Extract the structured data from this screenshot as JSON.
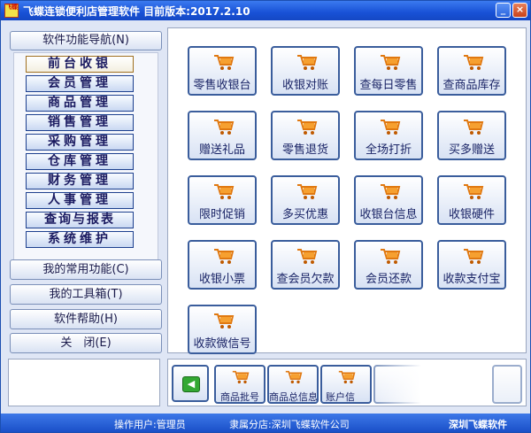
{
  "window": {
    "title": "飞蝶连锁便利店管理软件 目前版本:2017.2.10",
    "icon_text": "飞蝶"
  },
  "sidebar": {
    "header": "软件功能导航(N)",
    "items": [
      {
        "label": "前台收银",
        "active": true
      },
      {
        "label": "会员管理"
      },
      {
        "label": "商品管理"
      },
      {
        "label": "销售管理"
      },
      {
        "label": "采购管理"
      },
      {
        "label": "仓库管理"
      },
      {
        "label": "财务管理"
      },
      {
        "label": "人事管理"
      },
      {
        "label": "查询与报表"
      },
      {
        "label": "系统维护"
      }
    ],
    "buttons": [
      {
        "label": "我的常用功能(C)"
      },
      {
        "label": "我的工具箱(T)"
      },
      {
        "label": "软件帮助(H)"
      },
      {
        "label": "关　闭(E)"
      }
    ]
  },
  "main": {
    "buttons": [
      {
        "label": "零售收银台",
        "icon": "shopping-cart-icon"
      },
      {
        "label": "收银对账",
        "icon": "shopping-cart-icon"
      },
      {
        "label": "查每日零售",
        "icon": "shopping-cart-icon"
      },
      {
        "label": "查商品库存",
        "icon": "shopping-cart-icon"
      },
      {
        "label": "赠送礼品",
        "icon": "shopping-cart-icon"
      },
      {
        "label": "零售退货",
        "icon": "shopping-cart-icon"
      },
      {
        "label": "全场打折",
        "icon": "shopping-cart-icon"
      },
      {
        "label": "买多赠送",
        "icon": "shopping-cart-icon"
      },
      {
        "label": "限时促销",
        "icon": "shopping-cart-icon"
      },
      {
        "label": "多买优惠",
        "icon": "shopping-cart-icon"
      },
      {
        "label": "收银台信息",
        "icon": "shopping-cart-icon"
      },
      {
        "label": "收银硬件",
        "icon": "shopping-cart-icon"
      },
      {
        "label": "收银小票",
        "icon": "shopping-cart-icon"
      },
      {
        "label": "查会员欠款",
        "icon": "shopping-cart-icon"
      },
      {
        "label": "会员还款",
        "icon": "shopping-cart-icon"
      },
      {
        "label": "收款支付宝",
        "icon": "shopping-cart-icon"
      },
      {
        "label": "收款微信号",
        "icon": "shopping-cart-icon"
      }
    ]
  },
  "quickbar": {
    "back_icon": "back-arrow-icon",
    "items": [
      {
        "label": "商品批号"
      },
      {
        "label": "商品总信息"
      },
      {
        "label": "账户信"
      }
    ]
  },
  "status": {
    "operator": "操作用户:管理员",
    "branch": "隶属分店:深圳飞蝶软件公司",
    "brand": "深圳飞蝶软件"
  },
  "colors": {
    "title_blue": "#1851d6",
    "button_border": "#3a5d9c",
    "cart_orange": "#f08a1a",
    "back_green": "#33a833"
  }
}
